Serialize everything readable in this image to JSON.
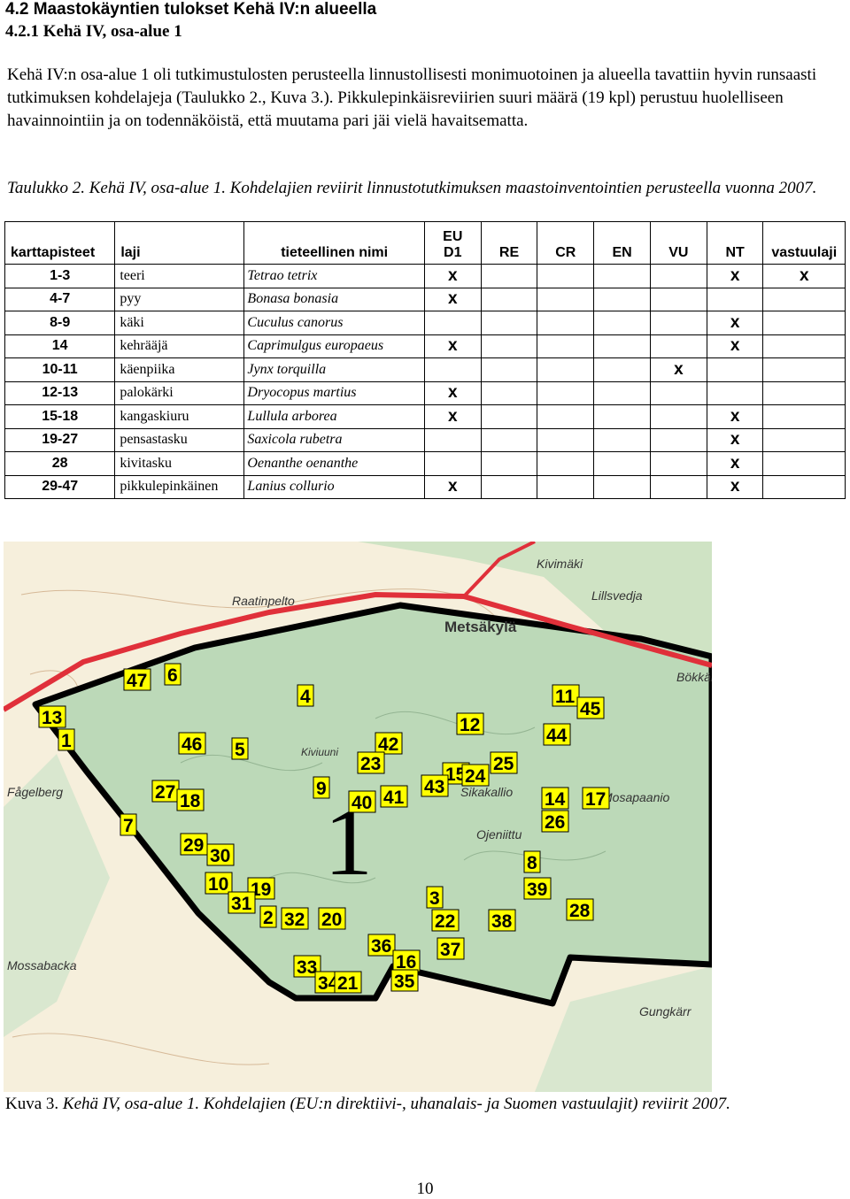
{
  "heading": {
    "main": "4.2 Maastokäyntien tulokset Kehä IV:n alueella",
    "sub": "4.2.1 Kehä IV, osa-alue 1"
  },
  "paragraph": "Kehä IV:n osa-alue 1 oli tutkimustulosten perusteella linnustollisesti monimuotoinen ja alueella tavattiin hyvin runsaasti tutkimuksen kohdelajeja (Taulukko 2., Kuva 3.). Pikkulepinkäisreviirien suuri määrä (19 kpl) perustuu huolelliseen havainnointiin ja on todennäköistä, että muutama pari jäi vielä havaitsematta.",
  "table_caption": "Taulukko 2. Kehä IV, osa-alue 1. Kohdelajien reviirit linnustotutkimuksen maastoinventointien perusteella vuonna 2007.",
  "table": {
    "headers": [
      "karttapisteet",
      "laji",
      "tieteellinen nimi",
      "EU D1",
      "RE",
      "CR",
      "EN",
      "VU",
      "NT",
      "vastuulaji"
    ],
    "header_eu_top": "EU",
    "header_eu_bottom": "D1",
    "mark": "x",
    "rows": [
      {
        "points": "1-3",
        "species": "teeri",
        "scientific": "Tetrao tetrix",
        "eu": "x",
        "re": "",
        "cr": "",
        "en": "",
        "vu": "",
        "nt": "x",
        "resp": "x"
      },
      {
        "points": "4-7",
        "species": "pyy",
        "scientific": "Bonasa bonasia",
        "eu": "x",
        "re": "",
        "cr": "",
        "en": "",
        "vu": "",
        "nt": "",
        "resp": ""
      },
      {
        "points": "8-9",
        "species": "käki",
        "scientific": "Cuculus canorus",
        "eu": "",
        "re": "",
        "cr": "",
        "en": "",
        "vu": "",
        "nt": "x",
        "resp": ""
      },
      {
        "points": "14",
        "species": "kehrääjä",
        "scientific": "Caprimulgus europaeus",
        "eu": "x",
        "re": "",
        "cr": "",
        "en": "",
        "vu": "",
        "nt": "x",
        "resp": ""
      },
      {
        "points": "10-11",
        "species": "käenpiika",
        "scientific": "Jynx torquilla",
        "eu": "",
        "re": "",
        "cr": "",
        "en": "",
        "vu": "x",
        "nt": "",
        "resp": ""
      },
      {
        "points": "12-13",
        "species": "palokärki",
        "scientific": "Dryocopus martius",
        "eu": "x",
        "re": "",
        "cr": "",
        "en": "",
        "vu": "",
        "nt": "",
        "resp": ""
      },
      {
        "points": "15-18",
        "species": "kangaskiuru",
        "scientific": "Lullula arborea",
        "eu": "x",
        "re": "",
        "cr": "",
        "en": "",
        "vu": "",
        "nt": "x",
        "resp": ""
      },
      {
        "points": "19-27",
        "species": "pensastasku",
        "scientific": "Saxicola rubetra",
        "eu": "",
        "re": "",
        "cr": "",
        "en": "",
        "vu": "",
        "nt": "x",
        "resp": ""
      },
      {
        "points": "28",
        "species": "kivitasku",
        "scientific": "Oenanthe oenanthe",
        "eu": "",
        "re": "",
        "cr": "",
        "en": "",
        "vu": "",
        "nt": "x",
        "resp": ""
      },
      {
        "points": "29-47",
        "species": "pikkulepinkäinen",
        "scientific": "Lanius collurio",
        "eu": "x",
        "re": "",
        "cr": "",
        "en": "",
        "vu": "",
        "nt": "x",
        "resp": ""
      }
    ]
  },
  "map": {
    "place_names": [
      "Kivimäki",
      "Metsäkylä",
      "Raatinpelto",
      "Lillsvedja",
      "Bökkär",
      "Kiviuuni",
      "Fågelberg",
      "Sikakallio",
      "Ojeniittu",
      "Mosapaanio",
      "Mossabacka",
      "Gungkärr"
    ],
    "area_label": "1",
    "colors": {
      "area_fill": "#bcd9b8",
      "red_line": "#e0303a",
      "boundary": "#000000",
      "marker_fill": "#ffff00",
      "field": "#f6efdc"
    },
    "markers": [
      "13",
      "1",
      "47",
      "6",
      "4",
      "11",
      "45",
      "12",
      "44",
      "46",
      "5",
      "42",
      "23",
      "15",
      "24",
      "25",
      "27",
      "18",
      "9",
      "40",
      "41",
      "43",
      "14",
      "17",
      "7",
      "26",
      "29",
      "30",
      "8",
      "10",
      "19",
      "39",
      "31",
      "2",
      "32",
      "20",
      "3",
      "22",
      "38",
      "28",
      "36",
      "16",
      "37",
      "33",
      "34",
      "21",
      "35"
    ]
  },
  "figure_caption": {
    "prefix": "Kuva 3. ",
    "text": "Kehä IV, osa-alue 1. Kohdelajien (EU:n direktiivi-, uhanalais- ja Suomen vastuulajit) reviirit 2007."
  },
  "page_number": "10"
}
